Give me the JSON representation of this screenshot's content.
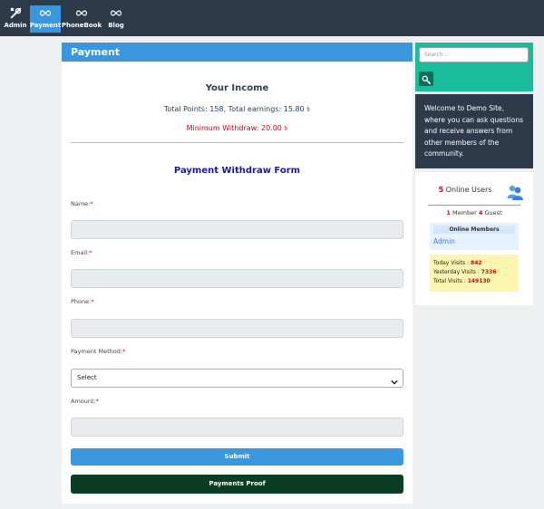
{
  "nav": {
    "items": [
      {
        "label": "Admin",
        "icon": "tools-icon"
      },
      {
        "label": "Payment",
        "icon": "infinity-icon",
        "active": true
      },
      {
        "label": "PhoneBook",
        "icon": "infinity-icon"
      },
      {
        "label": "Blog",
        "icon": "infinity-icon"
      }
    ]
  },
  "panel": {
    "title": "Payment",
    "income_title": "Your Income",
    "points_label": "Total Points:",
    "points_value": "158",
    "earnings_label": ", Total earnings:",
    "earnings_value": "15.80 ৳",
    "min_withdraw": "Minimum Withdraw: 20.00 ৳"
  },
  "form": {
    "title": "Payment Withdraw Form",
    "required_mark": "*",
    "name_label": "Name:",
    "email_label": "Email:",
    "phone_label": "Phone:",
    "method_label": "Payment Method:",
    "method_selected": "Select",
    "amount_label": "Amount:",
    "submit_label": "Submit",
    "proof_label": "Payments Proof"
  },
  "sidebar": {
    "search_placeholder": "Search...",
    "welcome": "Welcome to Demo Site, where you can ask questions and receive answers from other members of the community.",
    "online_count": "5",
    "online_label": "Online Users",
    "member_count": "1",
    "member_label": "Member",
    "guest_count": "4",
    "guest_label": "Guest",
    "members_heading": "Online Members",
    "member_name": "Admin",
    "today_label": "Today Visits :",
    "today_value": "842",
    "yesterday_label": "Yesterday Visits :",
    "yesterday_value": "7336",
    "total_label": "Total Visits :",
    "total_value": "149130"
  },
  "colors": {
    "topbar": "#2d3a4a",
    "accent": "#3a96dd",
    "search_panel": "#1abc9c",
    "proof_button": "#0b3d25",
    "required": "#d0021b"
  }
}
